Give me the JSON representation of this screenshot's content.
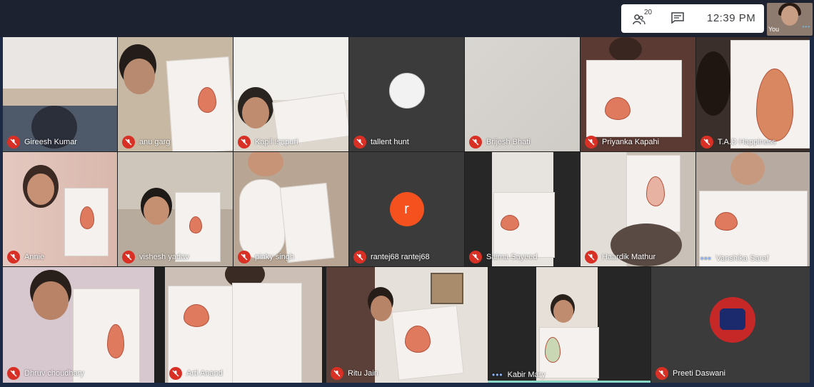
{
  "header": {
    "participant_count": "20",
    "time": "12:39 PM",
    "self_label": "You",
    "accent_color": "#1a73e8"
  },
  "tiles": [
    {
      "name": "Gireesh Kumar",
      "muted": true
    },
    {
      "name": "anu garg",
      "muted": true
    },
    {
      "name": "Kapil Isapuri",
      "muted": true
    },
    {
      "name": "tallent hunt",
      "muted": true
    },
    {
      "name": "Brijesh Bhati",
      "muted": true
    },
    {
      "name": "Priyanka Kapahi",
      "muted": true
    },
    {
      "name": "T.A.D Happiness",
      "muted": true
    },
    {
      "name": "Annie",
      "muted": true
    },
    {
      "name": "vishesh yadav",
      "muted": true
    },
    {
      "name": "pinky singh",
      "muted": true
    },
    {
      "name": "rantej68 rantej68",
      "muted": true,
      "avatar_letter": "r",
      "avatar_color": "#f4511e"
    },
    {
      "name": "Saima Sayeed",
      "muted": true
    },
    {
      "name": "Haardik Mathur",
      "muted": true
    },
    {
      "name": "Vanshika Saraf",
      "muted": false
    },
    {
      "name": "Dhruv choudhary",
      "muted": true
    },
    {
      "name": "Arti Anand",
      "muted": true
    },
    {
      "name": "Ritu Jain",
      "muted": true
    },
    {
      "name": "Kabir Mary",
      "muted": false
    },
    {
      "name": "Preeti Daswani",
      "muted": true
    }
  ]
}
